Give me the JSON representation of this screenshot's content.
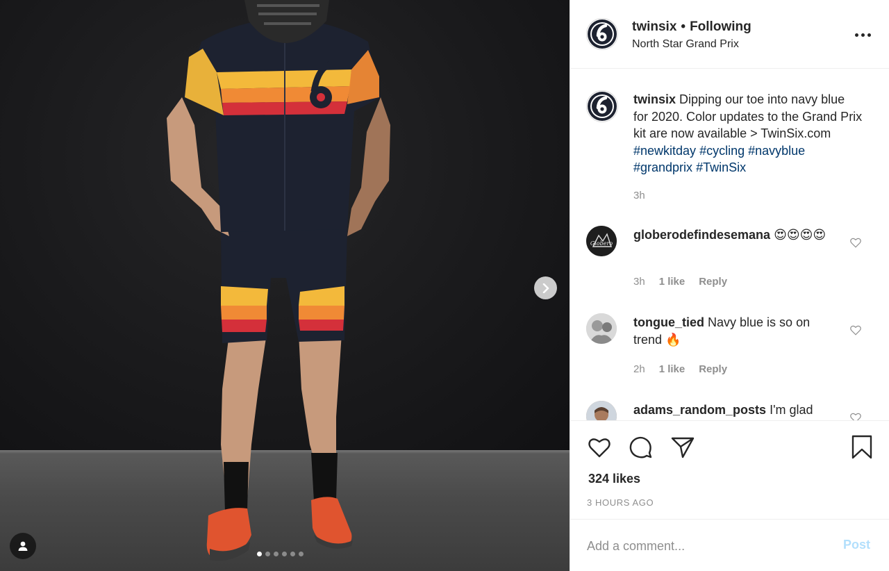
{
  "post": {
    "username": "twinsix",
    "separator": "•",
    "follow_status": "Following",
    "location": "North Star Grand Prix",
    "slide_count": 6,
    "active_slide": 1
  },
  "caption": {
    "username": "twinsix",
    "text": "Dipping our toe into navy blue for 2020. Color updates to the Grand Prix kit are now available > TwinSix.com",
    "hashtags": [
      "#newkitday",
      "#cycling",
      "#navyblue",
      "#grandprix",
      "#TwinSix"
    ],
    "time": "3h"
  },
  "comments": [
    {
      "username": "globerodefindesemana",
      "text": "😍😍😍😍",
      "time": "3h",
      "likes": "1 like",
      "reply": "Reply",
      "avatar_text": "Globero"
    },
    {
      "username": "tongue_tied",
      "text": "Navy blue is so on trend 🔥",
      "time": "2h",
      "likes": "1 like",
      "reply": "Reply"
    },
    {
      "username": "adams_random_posts",
      "text": "I'm glad"
    }
  ],
  "stats": {
    "likes": "324 likes",
    "time_ago": "3 HOURS AGO"
  },
  "comment_box": {
    "placeholder": "Add a comment...",
    "post_label": "Post"
  },
  "icons": {
    "like": "heart-icon",
    "comment": "comment-bubble-icon",
    "share": "paper-plane-icon",
    "save": "bookmark-icon",
    "more": "more-options-icon",
    "next": "chevron-right-icon",
    "tag": "user-tag-icon"
  },
  "colors": {
    "hashtag": "#00376b",
    "muted": "#8e8e8e",
    "post_disabled": "#b2dffc",
    "divider": "#efefef"
  },
  "brand_logo_text": "6"
}
